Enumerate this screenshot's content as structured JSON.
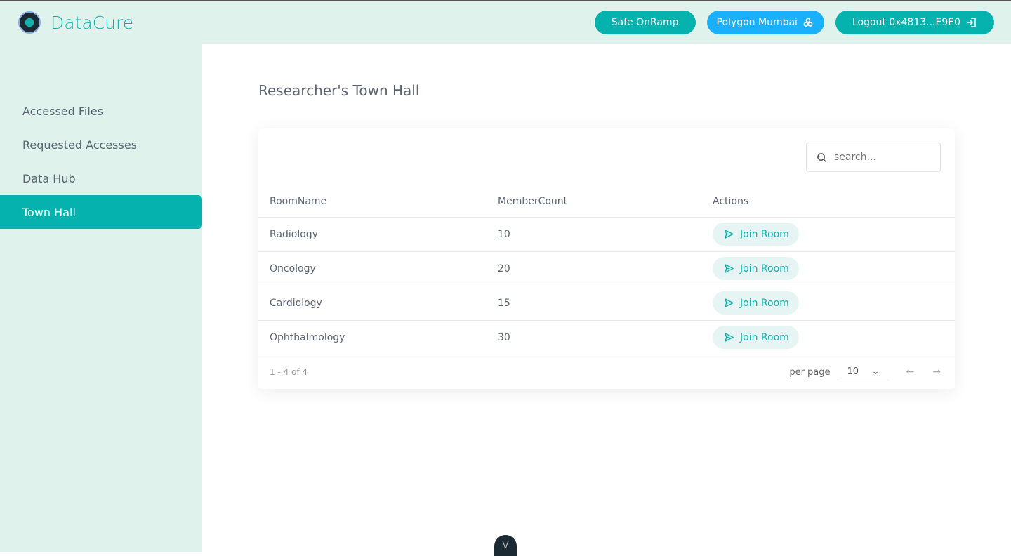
{
  "brand": {
    "name": "DataCure"
  },
  "header": {
    "safe_onramp": "Safe OnRamp",
    "network": "Polygon Mumbai",
    "logout": "Logout 0x4813...E9E0"
  },
  "sidebar": {
    "items": [
      {
        "label": "Accessed Files"
      },
      {
        "label": "Requested Accesses"
      },
      {
        "label": "Data Hub"
      },
      {
        "label": "Town Hall",
        "active": true
      }
    ]
  },
  "page": {
    "title": "Researcher's Town Hall"
  },
  "search": {
    "placeholder": "search...",
    "value": ""
  },
  "table": {
    "headers": [
      "RoomName",
      "MemberCount",
      "Actions"
    ],
    "rows": [
      {
        "name": "Radiology",
        "count": "10",
        "action": "Join Room"
      },
      {
        "name": "Oncology",
        "count": "20",
        "action": "Join Room"
      },
      {
        "name": "Cardiology",
        "count": "15",
        "action": "Join Room"
      },
      {
        "name": "Ophthalmology",
        "count": "30",
        "action": "Join Room"
      }
    ]
  },
  "pagination": {
    "range": "1 - 4 of 4",
    "per_page_label": "per page",
    "per_page": "10"
  },
  "colors": {
    "accent": "#05b2ad",
    "network": "#1ab0fb",
    "sidebar_bg": "#dff3ec"
  },
  "devtools": {
    "label": "V"
  }
}
